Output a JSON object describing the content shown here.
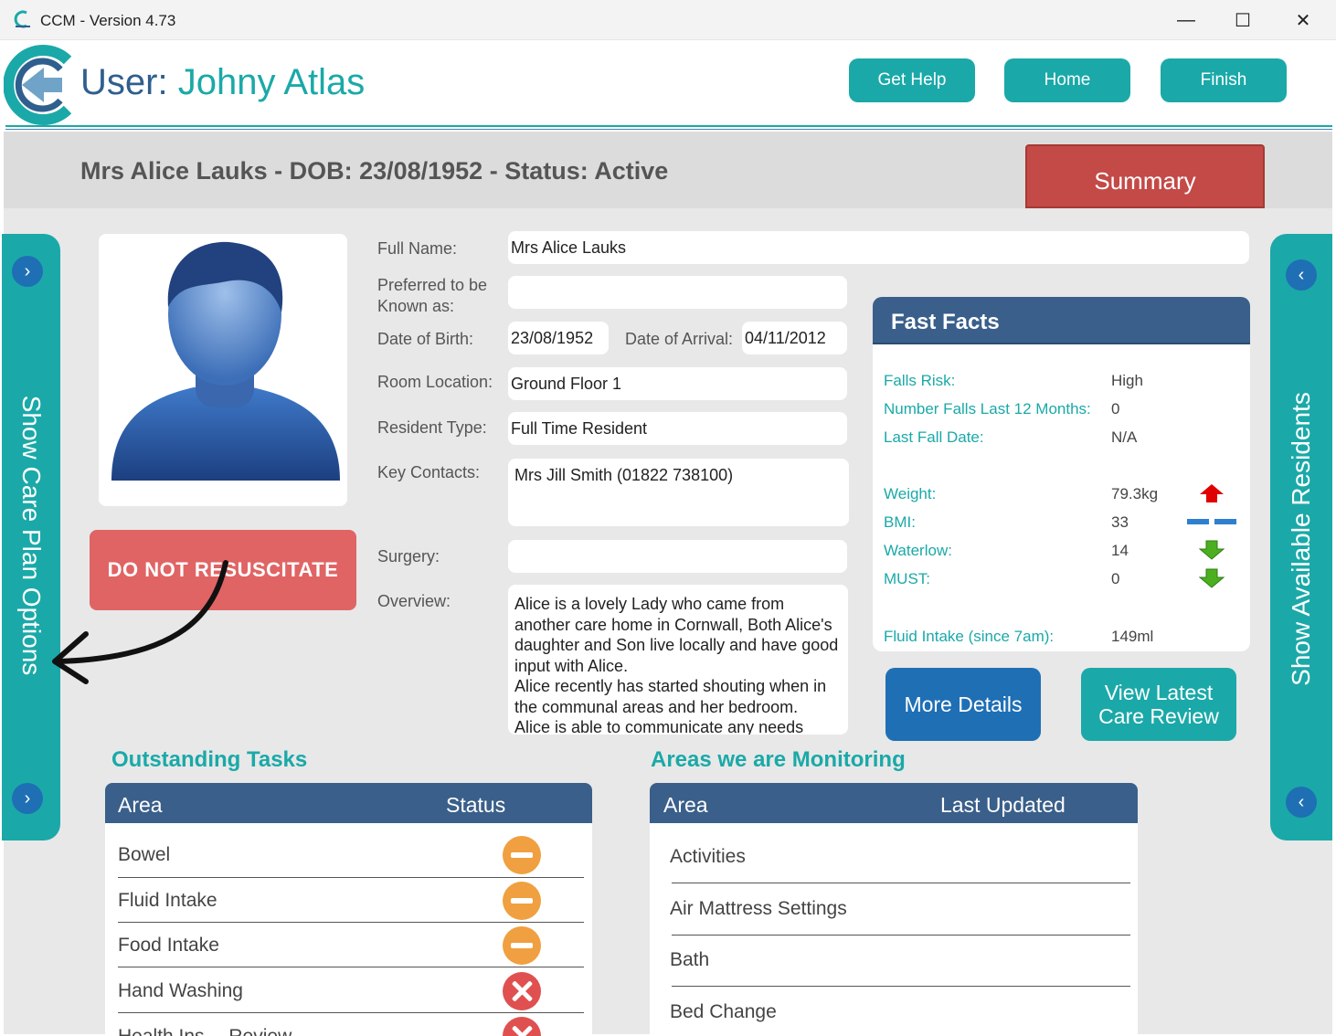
{
  "window": {
    "title": "CCM - Version 4.73",
    "controls": {
      "minimize": "—",
      "maximize": "☐",
      "close": "✕"
    }
  },
  "header": {
    "user_prefix": "User:",
    "user_name": "Johny Atlas",
    "buttons": {
      "help": "Get Help",
      "home": "Home",
      "finish": "Finish"
    }
  },
  "resident": {
    "title": "Mrs Alice Lauks - DOB: 23/08/1952 - Status: Active",
    "summary_button": "Summary",
    "dnr_label": "DO NOT RESUSCITATE"
  },
  "side_panels": {
    "left_label": "Show Care Plan Options",
    "right_label": "Show Available Residents"
  },
  "form": {
    "full_name_label": "Full Name:",
    "full_name": "Mrs Alice Lauks",
    "preferred_label_1": "Preferred to be",
    "preferred_label_2": "Known as:",
    "preferred": "",
    "dob_label": "Date of Birth:",
    "dob": "23/08/1952",
    "arrival_label": "Date of Arrival:",
    "arrival": "04/11/2012",
    "room_label": "Room Location:",
    "room": "Ground Floor 1",
    "type_label": "Resident Type:",
    "type": "Full Time Resident",
    "contacts_label": "Key Contacts:",
    "contacts": "Mrs Jill Smith (01822 738100)",
    "surgery_label": "Surgery:",
    "surgery": "",
    "overview_label": "Overview:",
    "overview_lines": [
      "Alice is a lovely Lady who came from",
      "another care home in Cornwall, Both Alice's",
      "daughter and Son live locally and have good",
      "input with Alice.",
      "Alice recently has started shouting when in",
      "the communal areas and her bedroom.",
      "Alice is able to communicate any needs"
    ]
  },
  "fast_facts": {
    "title": "Fast Facts",
    "rows": [
      {
        "label": "Falls Risk:",
        "value": "High"
      },
      {
        "label": "Number Falls Last 12 Months:",
        "value": "0"
      },
      {
        "label": "Last Fall Date:",
        "value": "N/A"
      },
      {
        "label": "Weight:",
        "value": "79.3kg",
        "trend": "up"
      },
      {
        "label": "BMI:",
        "value": "33",
        "trend": "same"
      },
      {
        "label": "Waterlow:",
        "value": "14",
        "trend": "down"
      },
      {
        "label": "MUST:",
        "value": "0",
        "trend": "down"
      },
      {
        "label": "Fluid Intake (since 7am):",
        "value": "149ml"
      }
    ],
    "colors": {
      "up": "#e00000",
      "same": "#2f7fd0",
      "down": "#4caf20"
    }
  },
  "actions": {
    "more_details": "More Details",
    "review_line1": "View Latest",
    "review_line2": "Care Review"
  },
  "outstanding": {
    "title": "Outstanding Tasks",
    "col_area": "Area",
    "col_status": "Status",
    "rows": [
      {
        "area": "Bowel",
        "status": "pending"
      },
      {
        "area": "Fluid Intake",
        "status": "pending"
      },
      {
        "area": "Food Intake",
        "status": "pending"
      },
      {
        "area": "Hand Washing",
        "status": "overdue"
      },
      {
        "area": "Health Ins… Review",
        "status": "overdue"
      }
    ]
  },
  "monitoring": {
    "title": "Areas we are Monitoring",
    "col_area": "Area",
    "col_updated": "Last Updated",
    "rows": [
      {
        "area": "Activities"
      },
      {
        "area": "Air Mattress Settings"
      },
      {
        "area": "Bath"
      },
      {
        "area": "Bed Change"
      }
    ]
  },
  "theme": {
    "teal": "#1aa9a8",
    "navy": "#3a5f8a",
    "blue_button": "#1f6fb5",
    "red_button": "#c44a47",
    "dnr_red": "#e06464"
  }
}
